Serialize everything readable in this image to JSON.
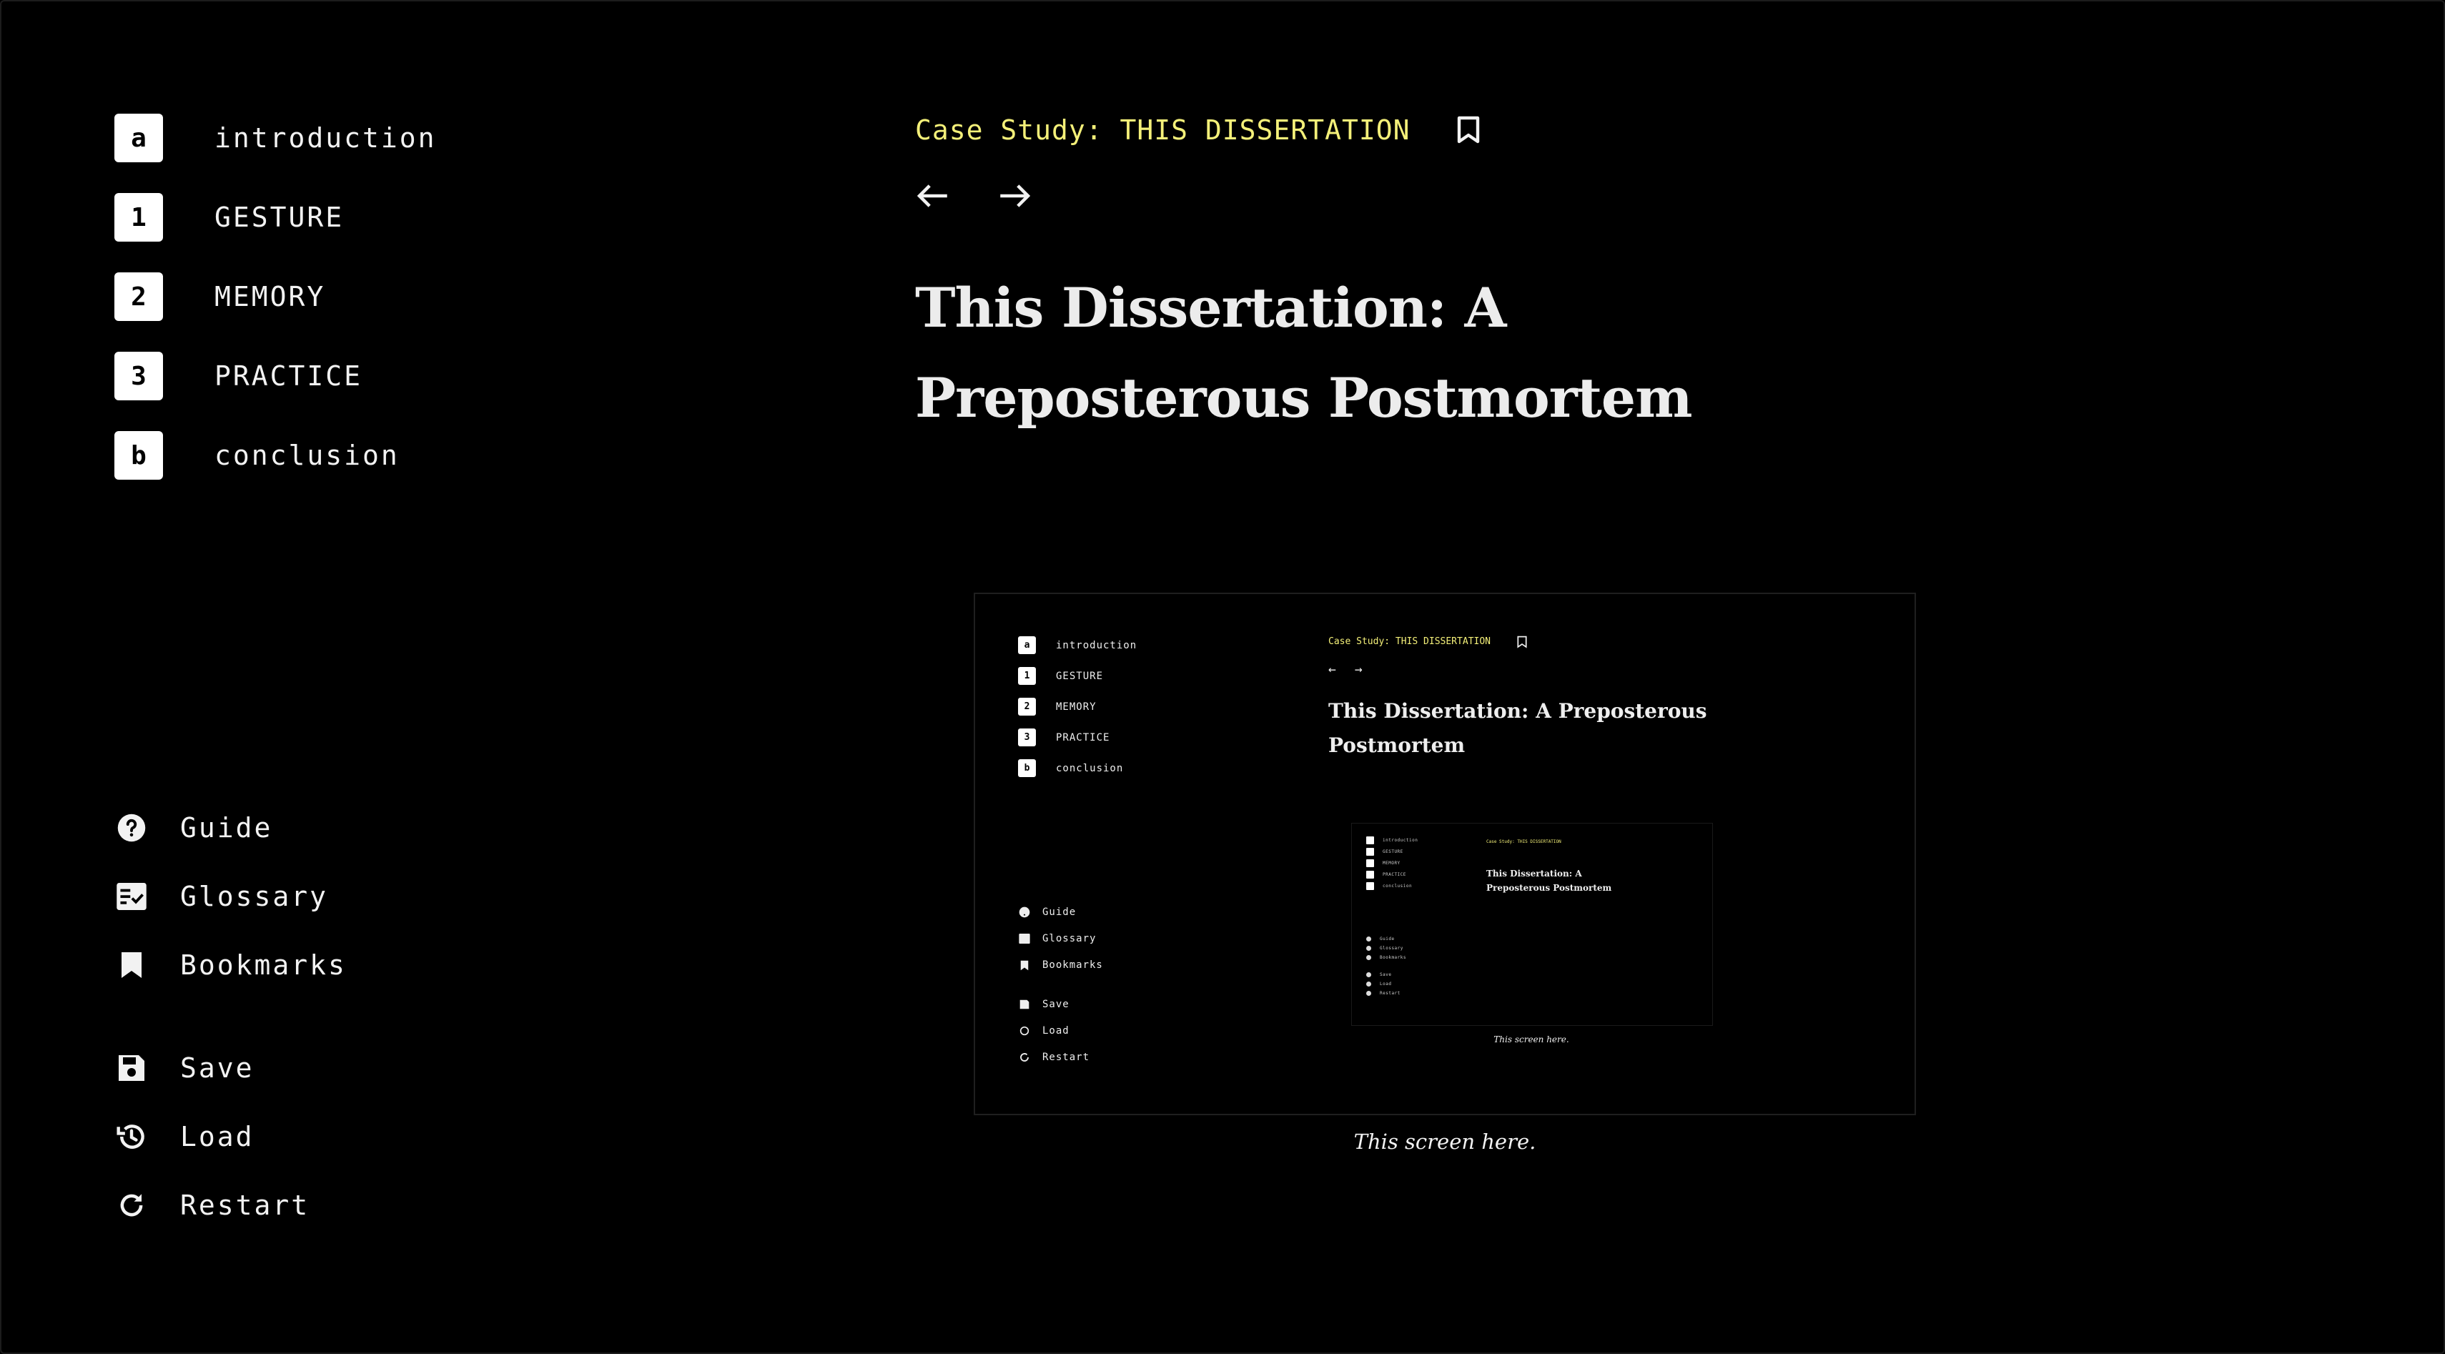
{
  "chapters": [
    {
      "badge": "a",
      "label": "introduction"
    },
    {
      "badge": "1",
      "label": "GESTURE"
    },
    {
      "badge": "2",
      "label": "MEMORY"
    },
    {
      "badge": "3",
      "label": "PRACTICE"
    },
    {
      "badge": "b",
      "label": "conclusion"
    }
  ],
  "menu": {
    "guide": "Guide",
    "glossary": "Glossary",
    "bookmarks": "Bookmarks",
    "save": "Save",
    "load": "Load",
    "restart": "Restart"
  },
  "icons": {
    "guide": "help-circle-icon",
    "glossary": "glossary-checklist-icon",
    "bookmarks": "bookmark-icon",
    "save": "floppy-disk-icon",
    "load": "history-icon",
    "restart": "refresh-icon",
    "prev": "arrow-left-icon",
    "next": "arrow-right-icon"
  },
  "header": {
    "case_study": "Case Study: THIS DISSERTATION"
  },
  "page_title": "This Dissertation: A Preposterous Postmortem",
  "figure": {
    "caption": "This screen here."
  },
  "colors": {
    "background": "#000000",
    "accent_yellow": "#f4f079",
    "text": "#f2f2f2"
  }
}
